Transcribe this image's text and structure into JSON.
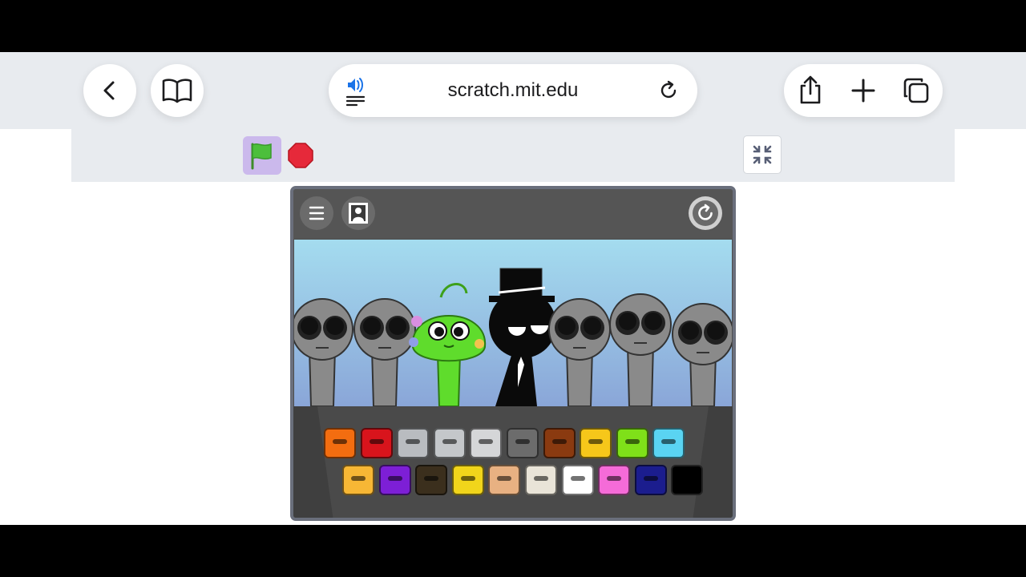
{
  "browser": {
    "url": "scratch.mit.edu",
    "back_icon": "chevron-left-icon",
    "reader_icon": "book-icon",
    "audio_icon": "speaker-wave-icon",
    "reload_icon": "reload-icon",
    "share_icon": "share-icon",
    "new_tab_icon": "plus-icon",
    "tabs_icon": "tabs-icon"
  },
  "scratch_controls": {
    "green_flag_icon": "green-flag-icon",
    "stop_icon": "stop-sign-icon",
    "unfullscreen_icon": "collapse-icon"
  },
  "game": {
    "menu_icon": "hamburger-menu-icon",
    "portrait_icon": "portrait-icon",
    "reset_icon": "reset-icon",
    "characters": [
      {
        "name": "gray-singer",
        "color": "#8a8a8a"
      },
      {
        "name": "gray-singer",
        "color": "#8a8a8a"
      },
      {
        "name": "green-slime-singer",
        "color": "#5fdc2c"
      },
      {
        "name": "black-tophat-singer",
        "color": "#0a0a0a"
      },
      {
        "name": "gray-singer",
        "color": "#8a8a8a"
      },
      {
        "name": "gray-singer",
        "color": "#8a8a8a"
      },
      {
        "name": "gray-singer",
        "color": "#8a8a8a"
      }
    ],
    "sound_icons_row1": [
      {
        "name": "orange-sound-icon",
        "color": "#f36d10"
      },
      {
        "name": "red-sound-icon",
        "color": "#d8141c"
      },
      {
        "name": "silver-antenna-sound-icon",
        "color": "#b9bcc0"
      },
      {
        "name": "silver-headphones-sound-icon",
        "color": "#c4c7ca"
      },
      {
        "name": "silver-cloud-sound-icon",
        "color": "#d5d6d8"
      },
      {
        "name": "dark-gray-cat-sound-icon",
        "color": "#6c6c6c"
      },
      {
        "name": "brown-bucket-sound-icon",
        "color": "#8a3a10"
      },
      {
        "name": "yellow-visor-sound-icon",
        "color": "#f6c71a"
      },
      {
        "name": "lime-spiky-sound-icon",
        "color": "#7fe019"
      },
      {
        "name": "cyan-headphones-sound-icon",
        "color": "#5ad4f2"
      }
    ],
    "sound_icons_row2": [
      {
        "name": "yellow-crown-sound-icon",
        "color": "#f7b735"
      },
      {
        "name": "purple-horns-sound-icon",
        "color": "#7d1fd6"
      },
      {
        "name": "dark-green-blob-sound-icon",
        "color": "#3b2f1d"
      },
      {
        "name": "yellow-squiggle-sound-icon",
        "color": "#f1d51b"
      },
      {
        "name": "tan-hair-sound-icon",
        "color": "#e8b182"
      },
      {
        "name": "propeller-cap-sound-icon",
        "color": "#e9e4d8"
      },
      {
        "name": "white-cat-sound-icon",
        "color": "#ffffff"
      },
      {
        "name": "pink-bunny-sound-icon",
        "color": "#f56bd8"
      },
      {
        "name": "navy-sound-icon",
        "color": "#1b1d8e"
      },
      {
        "name": "black-sound-icon",
        "color": "#000000"
      }
    ]
  }
}
